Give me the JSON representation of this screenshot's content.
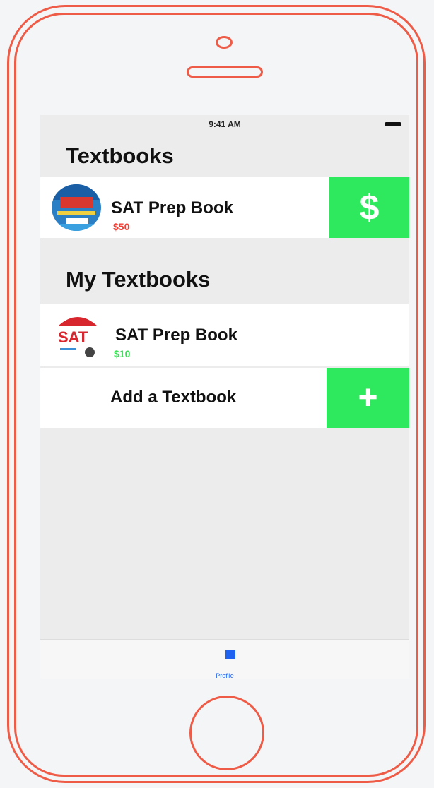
{
  "status_bar": {
    "time": "9:41 AM"
  },
  "sections": {
    "textbooks": {
      "title": "Textbooks",
      "item": {
        "title": "SAT Prep Book",
        "price": "$50",
        "action_icon": "$"
      }
    },
    "my_textbooks": {
      "title": "My Textbooks",
      "item": {
        "title": "SAT Prep Book",
        "price": "$10"
      },
      "add": {
        "label": "Add a Textbook",
        "action_icon": "+"
      }
    }
  },
  "tab_bar": {
    "items": [
      {
        "label": "Profile",
        "icon": "square-icon"
      }
    ]
  },
  "colors": {
    "accent_green": "#2ee85e",
    "price_red": "#ff3b30",
    "price_green": "#3ddc56",
    "tab_blue": "#1d62f0",
    "frame": "#ee5c48"
  }
}
